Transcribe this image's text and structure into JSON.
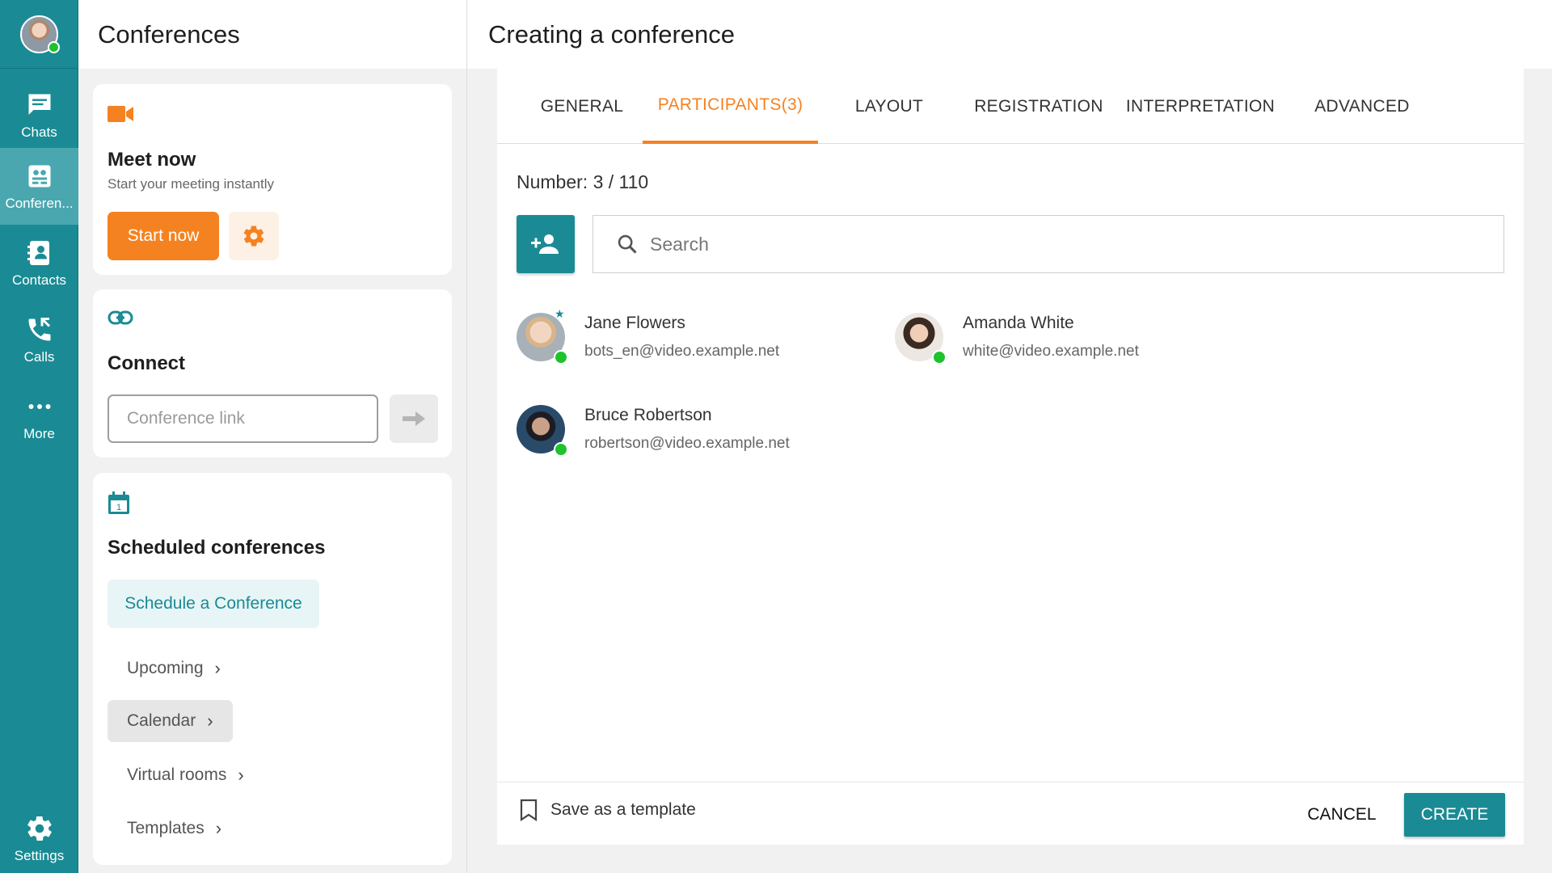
{
  "rail": {
    "items": [
      {
        "label": "Chats",
        "icon": "chat-icon"
      },
      {
        "label": "Conferen...",
        "icon": "conference-icon"
      },
      {
        "label": "Contacts",
        "icon": "contacts-icon"
      },
      {
        "label": "Calls",
        "icon": "calls-icon"
      },
      {
        "label": "More",
        "icon": "more-icon"
      }
    ],
    "settings_label": "Settings"
  },
  "mid": {
    "title": "Conferences",
    "meet": {
      "title": "Meet now",
      "subtitle": "Start your meeting instantly",
      "start_label": "Start now"
    },
    "connect": {
      "title": "Connect",
      "placeholder": "Conference link"
    },
    "scheduled": {
      "title": "Scheduled conferences",
      "calendar_day": "1",
      "schedule_label": "Schedule a Conference",
      "links": [
        "Upcoming",
        "Calendar",
        "Virtual rooms",
        "Templates"
      ],
      "chevron": "›"
    }
  },
  "right": {
    "title": "Creating a conference",
    "tabs": [
      "GENERAL",
      "PARTICIPANTS(3)",
      "LAYOUT",
      "REGISTRATION",
      "INTERPRETATION",
      "ADVANCED"
    ],
    "active_tab": "PARTICIPANTS(3)",
    "number": "Number: 3 / 110",
    "search_placeholder": "Search",
    "participants": [
      {
        "name": "Jane Flowers",
        "email": "bots_en@video.example.net",
        "online": true,
        "starred": true
      },
      {
        "name": "Amanda White",
        "email": "white@video.example.net",
        "online": true,
        "starred": false
      },
      {
        "name": "Bruce Robertson",
        "email": "robertson@video.example.net",
        "online": true,
        "starred": false
      }
    ],
    "footer": {
      "save_template": "Save as a template",
      "cancel": "CANCEL",
      "create": "CREATE"
    }
  },
  "colors": {
    "teal": "#1a8b94",
    "orange": "#f58220",
    "online": "#1fc22c"
  }
}
